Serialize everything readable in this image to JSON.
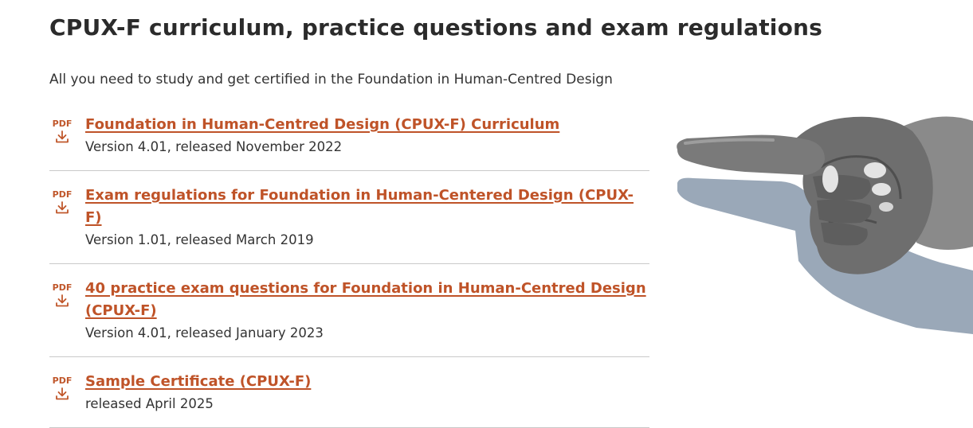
{
  "page": {
    "title": "CPUX-F curriculum, practice questions and exam regulations",
    "intro": "All you need to study and get certified in the Foundation in Human-Centred Design"
  },
  "documents": [
    {
      "icon_label": "PDF",
      "icon": "pdf-download-icon",
      "title": "Foundation in Human-Centred Design (CPUX-F) Curriculum",
      "meta": "Version 4.01, released November 2022"
    },
    {
      "icon_label": "PDF",
      "icon": "pdf-download-icon",
      "title": "Exam regulations for Foundation in Human-Centered Design (CPUX-F)",
      "meta": "Version 1.01, released March 2019"
    },
    {
      "icon_label": "PDF",
      "icon": "pdf-download-icon",
      "title": "40 practice exam questions for Foundation in Human-Centred Design (CPUX-F)",
      "meta": "Version 4.01, released January 2023"
    },
    {
      "icon_label": "PDF",
      "icon": "pdf-download-icon",
      "title": "Sample Certificate (CPUX-F)",
      "meta": "released April 2025"
    }
  ],
  "colors": {
    "accent": "#bf5328",
    "text": "#2b2b2b",
    "divider": "#c9c9c9",
    "shadow": "#9aa8b8"
  }
}
